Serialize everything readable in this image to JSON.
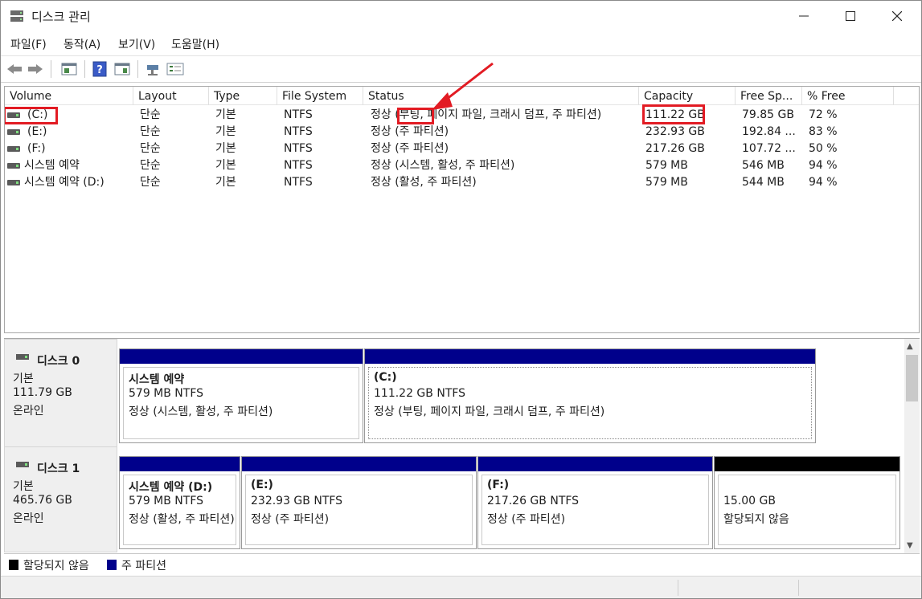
{
  "window": {
    "title": "디스크 관리"
  },
  "menu": [
    "파일(F)",
    "동작(A)",
    "보기(V)",
    "도움말(H)"
  ],
  "toolbar_icons": [
    "back-arrow-icon",
    "forward-arrow-icon",
    "properties-icon",
    "help-icon",
    "console-icon",
    "connect-icon",
    "settings-list-icon"
  ],
  "columns": [
    "Volume",
    "Layout",
    "Type",
    "File System",
    "Status",
    "Capacity",
    "Free Sp...",
    "% Free"
  ],
  "volumes": [
    {
      "volume": "(C:)",
      "layout": "단순",
      "type": "기본",
      "fs": "NTFS",
      "status": "정상 (부팅, 페이지 파일, 크래시 덤프, 주 파티션)",
      "capacity": "111.22 GB",
      "free": "79.85 GB",
      "pct": "72 %"
    },
    {
      "volume": "(E:)",
      "layout": "단순",
      "type": "기본",
      "fs": "NTFS",
      "status": "정상 (주 파티션)",
      "capacity": "232.93 GB",
      "free": "192.84 ...",
      "pct": "83 %"
    },
    {
      "volume": "(F:)",
      "layout": "단순",
      "type": "기본",
      "fs": "NTFS",
      "status": "정상 (주 파티션)",
      "capacity": "217.26 GB",
      "free": "107.72 ...",
      "pct": "50 %"
    },
    {
      "volume": "시스템 예약",
      "layout": "단순",
      "type": "기본",
      "fs": "NTFS",
      "status": "정상 (시스템, 활성, 주 파티션)",
      "capacity": "579 MB",
      "free": "546 MB",
      "pct": "94 %"
    },
    {
      "volume": "시스템 예약 (D:)",
      "layout": "단순",
      "type": "기본",
      "fs": "NTFS",
      "status": "정상 (활성, 주 파티션)",
      "capacity": "579 MB",
      "free": "544 MB",
      "pct": "94 %"
    }
  ],
  "disks": [
    {
      "name": "디스크 0",
      "type": "기본",
      "size": "111.79 GB",
      "state": "온라인",
      "partitions": [
        {
          "title": "시스템 예약",
          "line1": "579 MB NTFS",
          "line2": "정상 (시스템, 활성, 주 파티션)"
        },
        {
          "title": "(C:)",
          "line1": "111.22 GB NTFS",
          "line2": "정상 (부팅, 페이지 파일, 크래시 덤프, 주 파티션)"
        }
      ]
    },
    {
      "name": "디스크 1",
      "type": "기본",
      "size": "465.76 GB",
      "state": "온라인",
      "partitions": [
        {
          "title": "시스템 예약  (D:)",
          "line1": "579 MB NTFS",
          "line2": "정상 (활성, 주 파티션)"
        },
        {
          "title": "(E:)",
          "line1": "232.93 GB NTFS",
          "line2": "정상 (주 파티션)"
        },
        {
          "title": "(F:)",
          "line1": "217.26 GB NTFS",
          "line2": "정상 (주 파티션)"
        },
        {
          "title": "",
          "line1": "15.00 GB",
          "line2": "할당되지 않음"
        }
      ]
    }
  ],
  "legend": [
    {
      "label": "할당되지 않음",
      "color": "#000000"
    },
    {
      "label": "주 파티션",
      "color": "#00008b"
    }
  ],
  "colors": {
    "primary_partition": "#00008b",
    "unallocated": "#000000",
    "highlight": "#e21b23"
  }
}
